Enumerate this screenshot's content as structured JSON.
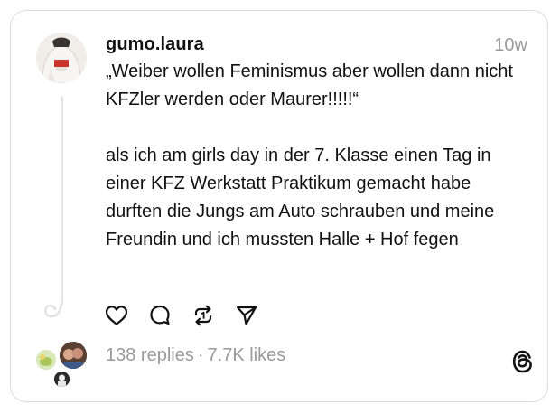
{
  "post": {
    "username": "gumo.laura",
    "timestamp": "10w",
    "quote": "„Weiber wollen Feminismus aber wollen dann nicht KFZler werden oder Maurer!!!!!“",
    "body": "als ich am girls day in der 7. Klasse einen Tag in einer KFZ Werkstatt Praktikum gemacht habe durften die Jungs am Auto schrauben und meine Freundin und ich mussten Halle + Hof fegen"
  },
  "actions": {
    "like_icon": "heart-icon",
    "reply_icon": "comment-bubble-icon",
    "repost_icon": "repost-icon",
    "share_icon": "send-icon"
  },
  "stats": {
    "replies": "138 replies",
    "separator": "·",
    "likes": "7.7K likes"
  },
  "brand": {
    "logo_icon": "threads-logo-icon"
  },
  "colors": {
    "text": "#111111",
    "muted": "#9a9a9a",
    "border": "#dcdcdc",
    "thread_line": "#e5e5e5"
  }
}
